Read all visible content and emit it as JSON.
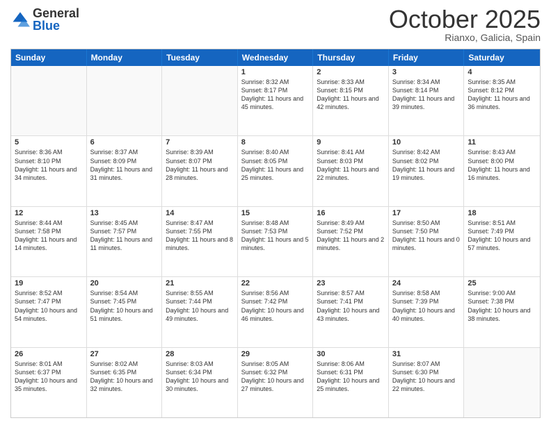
{
  "logo": {
    "general": "General",
    "blue": "Blue"
  },
  "header": {
    "month": "October 2025",
    "location": "Rianxo, Galicia, Spain"
  },
  "days": [
    "Sunday",
    "Monday",
    "Tuesday",
    "Wednesday",
    "Thursday",
    "Friday",
    "Saturday"
  ],
  "weeks": [
    [
      {
        "day": "",
        "content": ""
      },
      {
        "day": "",
        "content": ""
      },
      {
        "day": "",
        "content": ""
      },
      {
        "day": "1",
        "content": "Sunrise: 8:32 AM\nSunset: 8:17 PM\nDaylight: 11 hours and 45 minutes."
      },
      {
        "day": "2",
        "content": "Sunrise: 8:33 AM\nSunset: 8:15 PM\nDaylight: 11 hours and 42 minutes."
      },
      {
        "day": "3",
        "content": "Sunrise: 8:34 AM\nSunset: 8:14 PM\nDaylight: 11 hours and 39 minutes."
      },
      {
        "day": "4",
        "content": "Sunrise: 8:35 AM\nSunset: 8:12 PM\nDaylight: 11 hours and 36 minutes."
      }
    ],
    [
      {
        "day": "5",
        "content": "Sunrise: 8:36 AM\nSunset: 8:10 PM\nDaylight: 11 hours and 34 minutes."
      },
      {
        "day": "6",
        "content": "Sunrise: 8:37 AM\nSunset: 8:09 PM\nDaylight: 11 hours and 31 minutes."
      },
      {
        "day": "7",
        "content": "Sunrise: 8:39 AM\nSunset: 8:07 PM\nDaylight: 11 hours and 28 minutes."
      },
      {
        "day": "8",
        "content": "Sunrise: 8:40 AM\nSunset: 8:05 PM\nDaylight: 11 hours and 25 minutes."
      },
      {
        "day": "9",
        "content": "Sunrise: 8:41 AM\nSunset: 8:03 PM\nDaylight: 11 hours and 22 minutes."
      },
      {
        "day": "10",
        "content": "Sunrise: 8:42 AM\nSunset: 8:02 PM\nDaylight: 11 hours and 19 minutes."
      },
      {
        "day": "11",
        "content": "Sunrise: 8:43 AM\nSunset: 8:00 PM\nDaylight: 11 hours and 16 minutes."
      }
    ],
    [
      {
        "day": "12",
        "content": "Sunrise: 8:44 AM\nSunset: 7:58 PM\nDaylight: 11 hours and 14 minutes."
      },
      {
        "day": "13",
        "content": "Sunrise: 8:45 AM\nSunset: 7:57 PM\nDaylight: 11 hours and 11 minutes."
      },
      {
        "day": "14",
        "content": "Sunrise: 8:47 AM\nSunset: 7:55 PM\nDaylight: 11 hours and 8 minutes."
      },
      {
        "day": "15",
        "content": "Sunrise: 8:48 AM\nSunset: 7:53 PM\nDaylight: 11 hours and 5 minutes."
      },
      {
        "day": "16",
        "content": "Sunrise: 8:49 AM\nSunset: 7:52 PM\nDaylight: 11 hours and 2 minutes."
      },
      {
        "day": "17",
        "content": "Sunrise: 8:50 AM\nSunset: 7:50 PM\nDaylight: 11 hours and 0 minutes."
      },
      {
        "day": "18",
        "content": "Sunrise: 8:51 AM\nSunset: 7:49 PM\nDaylight: 10 hours and 57 minutes."
      }
    ],
    [
      {
        "day": "19",
        "content": "Sunrise: 8:52 AM\nSunset: 7:47 PM\nDaylight: 10 hours and 54 minutes."
      },
      {
        "day": "20",
        "content": "Sunrise: 8:54 AM\nSunset: 7:45 PM\nDaylight: 10 hours and 51 minutes."
      },
      {
        "day": "21",
        "content": "Sunrise: 8:55 AM\nSunset: 7:44 PM\nDaylight: 10 hours and 49 minutes."
      },
      {
        "day": "22",
        "content": "Sunrise: 8:56 AM\nSunset: 7:42 PM\nDaylight: 10 hours and 46 minutes."
      },
      {
        "day": "23",
        "content": "Sunrise: 8:57 AM\nSunset: 7:41 PM\nDaylight: 10 hours and 43 minutes."
      },
      {
        "day": "24",
        "content": "Sunrise: 8:58 AM\nSunset: 7:39 PM\nDaylight: 10 hours and 40 minutes."
      },
      {
        "day": "25",
        "content": "Sunrise: 9:00 AM\nSunset: 7:38 PM\nDaylight: 10 hours and 38 minutes."
      }
    ],
    [
      {
        "day": "26",
        "content": "Sunrise: 8:01 AM\nSunset: 6:37 PM\nDaylight: 10 hours and 35 minutes."
      },
      {
        "day": "27",
        "content": "Sunrise: 8:02 AM\nSunset: 6:35 PM\nDaylight: 10 hours and 32 minutes."
      },
      {
        "day": "28",
        "content": "Sunrise: 8:03 AM\nSunset: 6:34 PM\nDaylight: 10 hours and 30 minutes."
      },
      {
        "day": "29",
        "content": "Sunrise: 8:05 AM\nSunset: 6:32 PM\nDaylight: 10 hours and 27 minutes."
      },
      {
        "day": "30",
        "content": "Sunrise: 8:06 AM\nSunset: 6:31 PM\nDaylight: 10 hours and 25 minutes."
      },
      {
        "day": "31",
        "content": "Sunrise: 8:07 AM\nSunset: 6:30 PM\nDaylight: 10 hours and 22 minutes."
      },
      {
        "day": "",
        "content": ""
      }
    ]
  ]
}
